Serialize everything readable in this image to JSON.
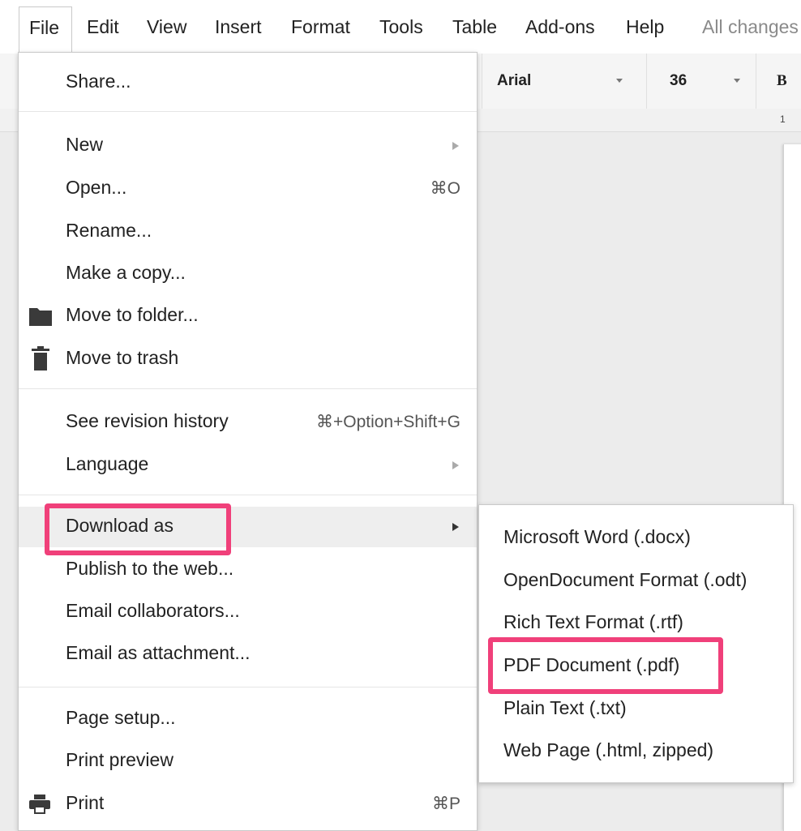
{
  "menubar": {
    "items": [
      "File",
      "Edit",
      "View",
      "Insert",
      "Format",
      "Tools",
      "Table",
      "Add-ons",
      "Help"
    ],
    "save_status": "All changes"
  },
  "toolbar": {
    "font": "Arial",
    "font_size": "36",
    "bold": "B"
  },
  "ruler": {
    "mark": "1"
  },
  "file_menu": {
    "share": "Share...",
    "new": "New",
    "open": "Open...",
    "open_shortcut": "⌘O",
    "rename": "Rename...",
    "make_copy": "Make a copy...",
    "move_to_folder": "Move to folder...",
    "move_to_trash": "Move to trash",
    "revision_history": "See revision history",
    "revision_shortcut": "⌘+Option+Shift+G",
    "language": "Language",
    "download_as": "Download as",
    "publish": "Publish to the web...",
    "email_collaborators": "Email collaborators...",
    "email_attachment": "Email as attachment...",
    "page_setup": "Page setup...",
    "print_preview": "Print preview",
    "print": "Print",
    "print_shortcut": "⌘P"
  },
  "download_submenu": {
    "items": [
      "Microsoft Word (.docx)",
      "OpenDocument Format (.odt)",
      "Rich Text Format (.rtf)",
      "PDF Document (.pdf)",
      "Plain Text (.txt)",
      "Web Page (.html, zipped)"
    ]
  },
  "colors": {
    "highlight": "#f0407a",
    "hover": "#eeeeee"
  },
  "icons": {
    "move_to_folder": "folder-icon",
    "move_to_trash": "trash-icon",
    "print": "printer-icon"
  }
}
